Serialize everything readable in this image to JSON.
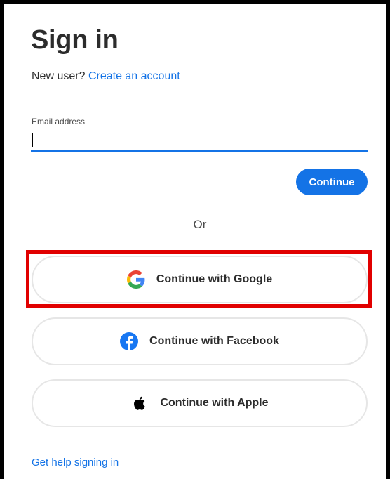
{
  "page": {
    "title": "Sign in",
    "new_user_prefix": "New user?",
    "create_account_link": "Create an account"
  },
  "email": {
    "label": "Email address",
    "value": ""
  },
  "continue_button": "Continue",
  "divider": "Or",
  "social": {
    "google": "Continue with Google",
    "facebook": "Continue with Facebook",
    "apple": "Continue with Apple"
  },
  "help_link": "Get help signing in",
  "colors": {
    "accent": "#1473e6",
    "highlight": "#e10000",
    "facebook": "#1877f2"
  }
}
